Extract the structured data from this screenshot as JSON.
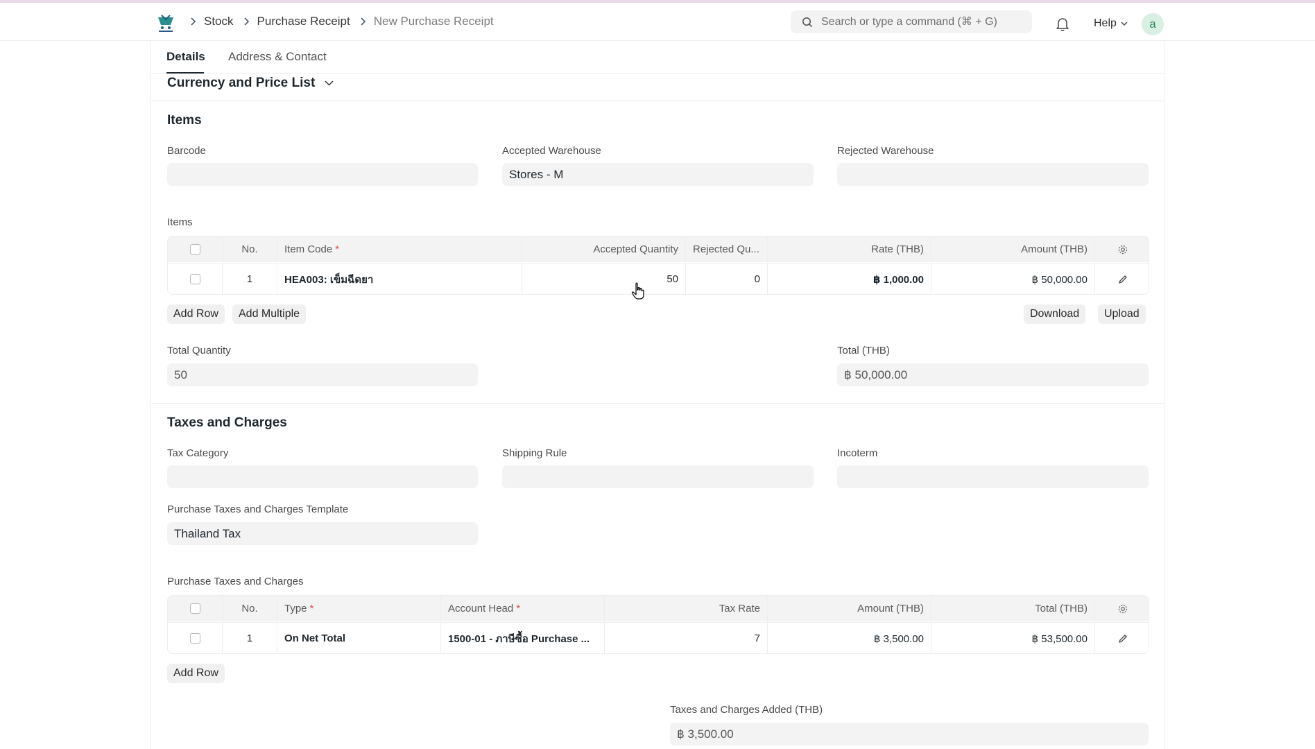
{
  "navbar": {
    "breadcrumbs": [
      "Stock",
      "Purchase Receipt",
      "New Purchase Receipt"
    ],
    "search_placeholder": "Search or type a command (⌘ + G)",
    "help_label": "Help",
    "avatar_initial": "a"
  },
  "tabs": [
    "Details",
    "Address & Contact"
  ],
  "currency_section": {
    "title": "Currency and Price List"
  },
  "items_section": {
    "title": "Items",
    "barcode_label": "Barcode",
    "barcode_value": "",
    "accepted_warehouse_label": "Accepted Warehouse",
    "accepted_warehouse_value": "Stores - M",
    "rejected_warehouse_label": "Rejected Warehouse",
    "rejected_warehouse_value": "",
    "table_label": "Items",
    "columns": [
      "No.",
      "Item Code",
      "Accepted Quantity",
      "Rejected Qu...",
      "Rate (THB)",
      "Amount (THB)"
    ],
    "rows": [
      {
        "no": "1",
        "item_code": "HEA003: เข็มฉีดยา",
        "accepted_qty": "50",
        "rejected_qty": "0",
        "rate": "฿ 1,000.00",
        "amount": "฿ 50,000.00"
      }
    ],
    "buttons": {
      "add_row": "Add Row",
      "add_multiple": "Add Multiple",
      "download": "Download",
      "upload": "Upload"
    },
    "total_quantity_label": "Total Quantity",
    "total_quantity_value": "50",
    "total_label": "Total (THB)",
    "total_value": "฿ 50,000.00"
  },
  "taxes_section": {
    "title": "Taxes and Charges",
    "tax_category_label": "Tax Category",
    "shipping_rule_label": "Shipping Rule",
    "incoterm_label": "Incoterm",
    "template_label": "Purchase Taxes and Charges Template",
    "template_value": "Thailand Tax",
    "table_label": "Purchase Taxes and Charges",
    "columns": [
      "No.",
      "Type",
      "Account Head",
      "Tax Rate",
      "Amount (THB)",
      "Total (THB)"
    ],
    "rows": [
      {
        "no": "1",
        "type": "On Net Total",
        "account_head": "1500-01 - ภาษีซื้อ Purchase ...",
        "tax_rate": "7",
        "amount": "฿ 3,500.00",
        "total": "฿ 53,500.00"
      }
    ],
    "add_row": "Add Row",
    "added_label": "Taxes and Charges Added (THB)",
    "added_value": "฿ 3,500.00"
  }
}
